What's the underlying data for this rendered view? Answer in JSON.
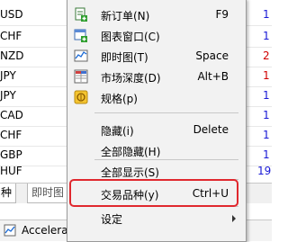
{
  "background": {
    "symbols": [
      "USD",
      "CHF",
      "NZD",
      "JPY",
      "JPY",
      "CAD",
      "CHF",
      "GBP",
      "HUF"
    ],
    "right_values": [
      "1",
      "1",
      "2",
      "1",
      "1",
      "1",
      "1",
      "1",
      "19"
    ],
    "tabs": [
      "种",
      "即时图"
    ],
    "footer_label": "Accelerat"
  },
  "menu": {
    "items": [
      {
        "label": "新订单(N)",
        "shortcut": "F9",
        "icon": "new-order-icon"
      },
      {
        "label": "图表窗口(C)",
        "shortcut": "",
        "icon": "chart-window-icon"
      },
      {
        "label": "即时图(T)",
        "shortcut": "Space",
        "icon": "tick-chart-icon"
      },
      {
        "label": "市场深度(D)",
        "shortcut": "Alt+B",
        "icon": "market-depth-icon"
      },
      {
        "label": "规格(p)",
        "shortcut": "",
        "icon": "specification-icon"
      },
      {
        "label": "隐藏(i)",
        "shortcut": "Delete"
      },
      {
        "label": "全部隐藏(H)",
        "shortcut": ""
      },
      {
        "label": "全部显示(S)",
        "shortcut": ""
      },
      {
        "label": "交易品种(y)",
        "shortcut": "Ctrl+U"
      },
      {
        "label": "设定",
        "shortcut": "",
        "submenu": true
      }
    ]
  },
  "colors": {
    "highlight_border": "#e0282e",
    "value_blue": "#1a1ad6",
    "value_red": "#d00000"
  }
}
